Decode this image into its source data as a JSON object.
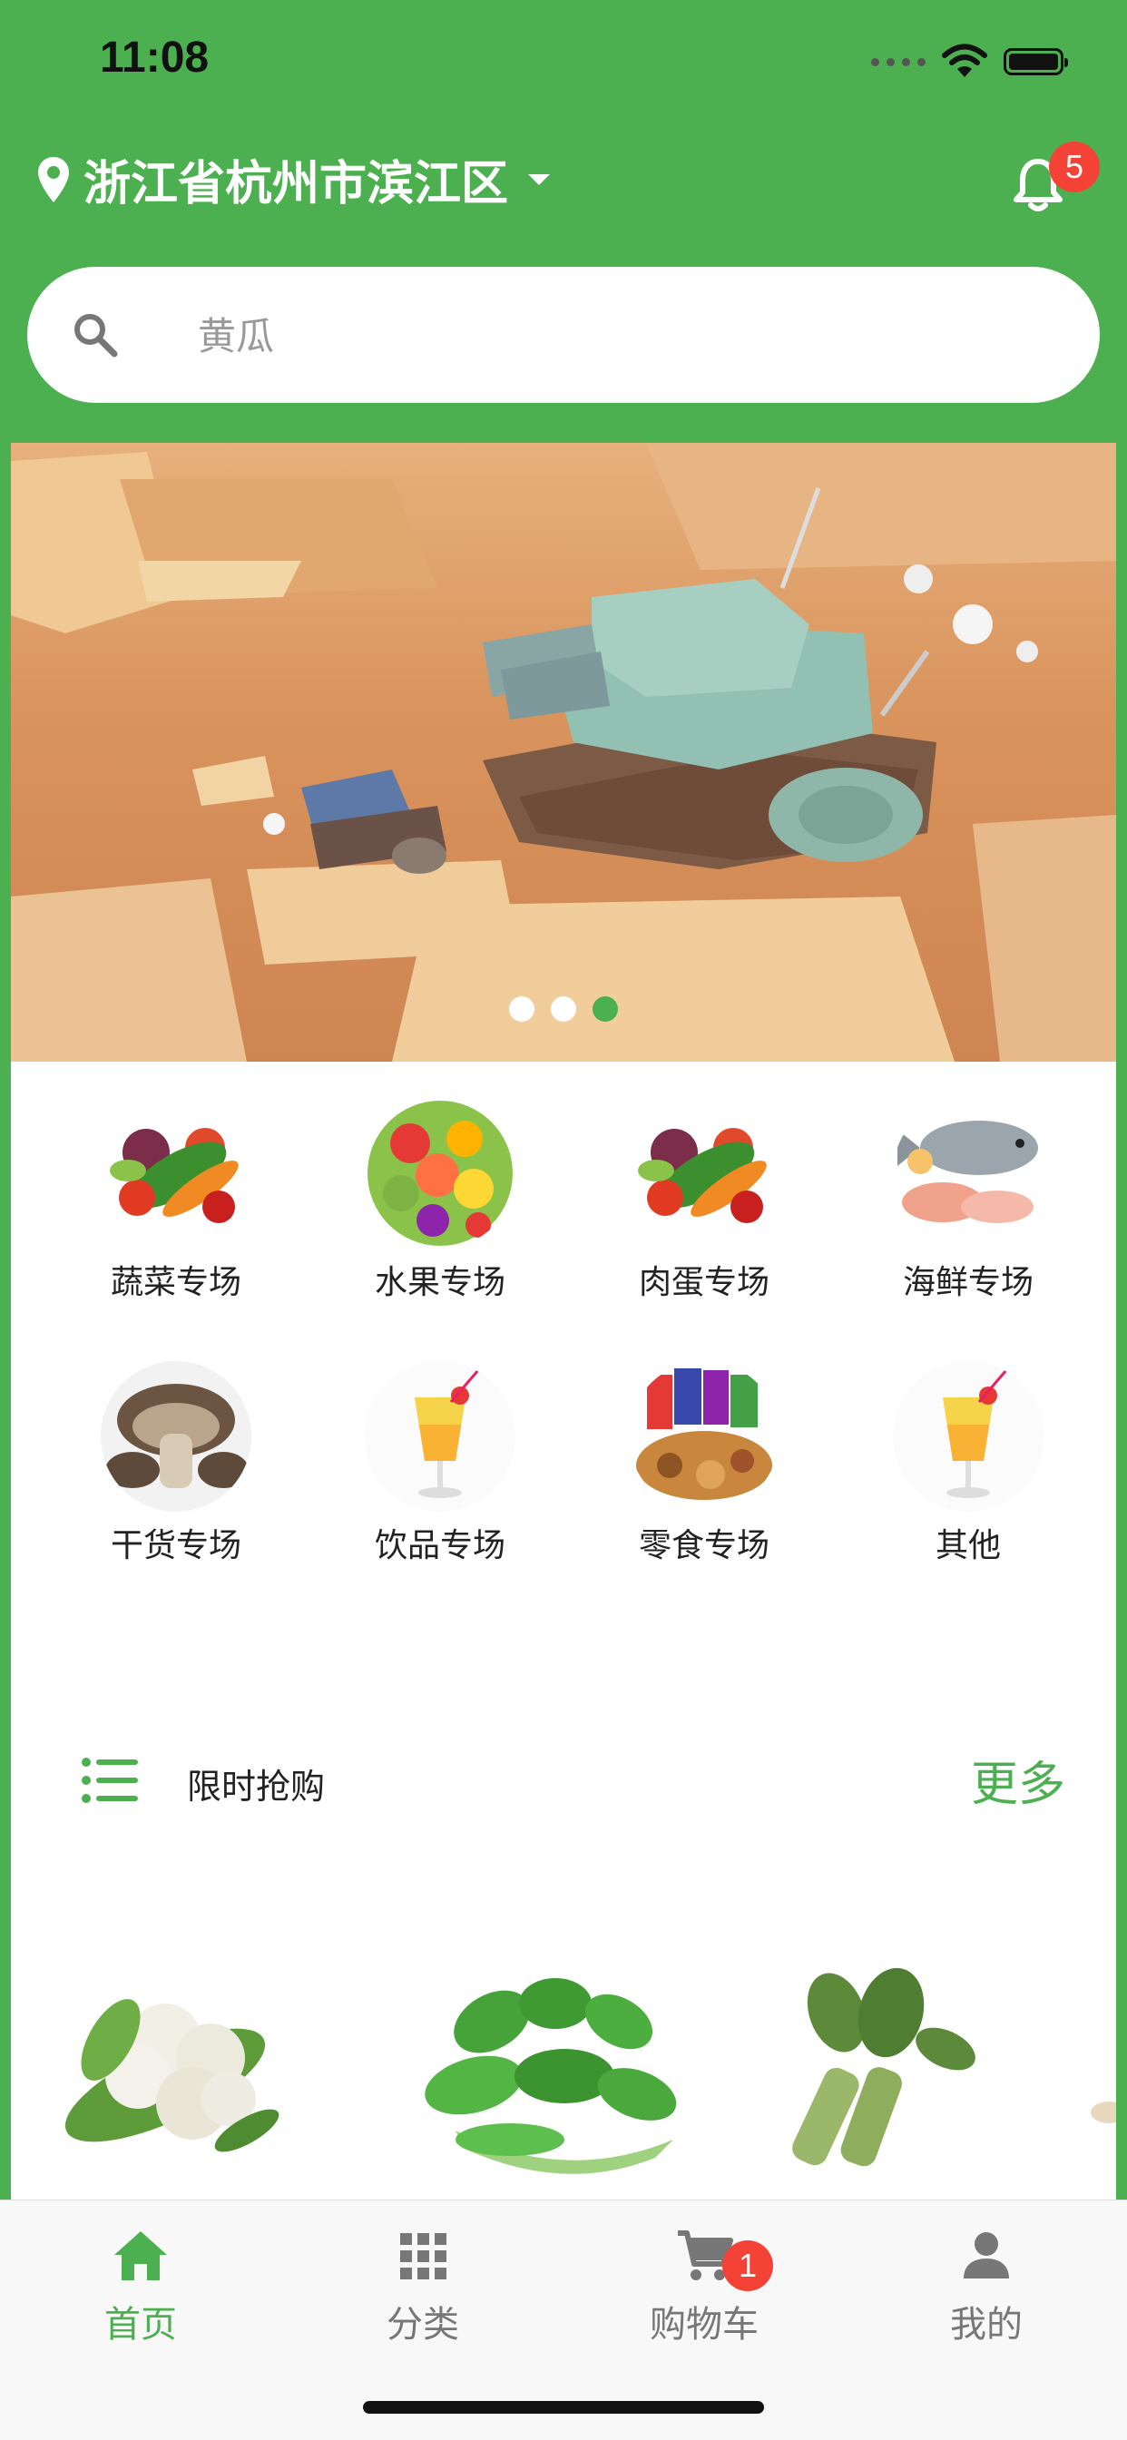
{
  "status_bar": {
    "time": "11:08"
  },
  "header": {
    "location": "浙江省杭州市滨江区",
    "notification_count": "5"
  },
  "search": {
    "placeholder": "黄瓜"
  },
  "banner": {
    "slide_count": 3,
    "active_index": 2
  },
  "categories": [
    {
      "label": "蔬菜专场",
      "icon": "vegetables-image"
    },
    {
      "label": "水果专场",
      "icon": "fruits-image"
    },
    {
      "label": "肉蛋专场",
      "icon": "meat-eggs-image"
    },
    {
      "label": "海鲜专场",
      "icon": "seafood-image"
    },
    {
      "label": "干货专场",
      "icon": "dried-goods-image"
    },
    {
      "label": "饮品专场",
      "icon": "drinks-image"
    },
    {
      "label": "零食专场",
      "icon": "snacks-image"
    },
    {
      "label": "其他",
      "icon": "other-drink-image"
    }
  ],
  "flash_sale": {
    "title": "限时抢购",
    "more": "更多"
  },
  "products": [
    {
      "icon": "cauliflower-image"
    },
    {
      "icon": "bok-choy-image"
    },
    {
      "icon": "celtuce-image"
    }
  ],
  "tabbar": {
    "items": [
      {
        "label": "首页",
        "icon": "home-icon",
        "active": true
      },
      {
        "label": "分类",
        "icon": "grid-icon",
        "active": false
      },
      {
        "label": "购物车",
        "icon": "cart-icon",
        "active": false
      },
      {
        "label": "我的",
        "icon": "person-icon",
        "active": false
      }
    ],
    "cart_count": "1"
  },
  "colors": {
    "primary": "#4caf50",
    "badge": "#f44336"
  }
}
